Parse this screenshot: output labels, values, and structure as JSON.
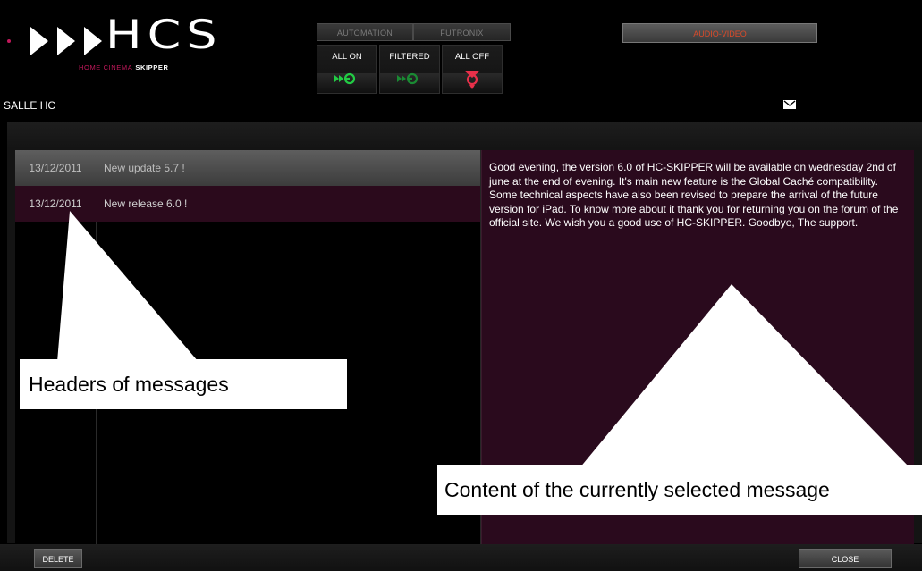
{
  "app": {
    "logo_text": "HCS",
    "logo_sub_1": "HOME CINEMA",
    "logo_sub_2": "SKIPPER"
  },
  "top_tabs": {
    "automation": "AUTOMATION",
    "futronix": "FUTRONIX",
    "audio_video": "AUDIO-VIDEO"
  },
  "mode_buttons": [
    {
      "label": "ALL ON",
      "icon": "power-on-icon",
      "color": "#22cc44"
    },
    {
      "label": "FILTERED",
      "icon": "power-filtered-icon",
      "color": "#22cc44"
    },
    {
      "label": "ALL OFF",
      "icon": "power-off-icon",
      "color": "#e8304a"
    }
  ],
  "header": {
    "room": "SALLE HC",
    "mail_icon": "envelope-icon"
  },
  "messages": [
    {
      "date": "13/12/2011",
      "title": "New update 5.7 !"
    },
    {
      "date": "13/12/2011",
      "title": "New release 6.0 !"
    }
  ],
  "selected_message": {
    "body": "Good evening, the version 6.0 of HC-SKIPPER will be available on wednesday 2nd of june at the end of evening. It's main new feature is the Global Caché compatibility. Some technical aspects have also been revised to prepare the arrival of the future version for iPad. To know more about it thank you for returning you on the forum of the official site. We wish you a good use of HC-SKIPPER. Goodbye, The support."
  },
  "footer": {
    "delete_label": "DELETE",
    "close_label": "CLOSE"
  },
  "annotations": {
    "headers_label": "Headers of messages",
    "content_label": "Content of the currently selected message"
  },
  "colors": {
    "accent": "#c2185b",
    "message_bg": "#2a0a1d",
    "av_tab_text": "#d94a2a"
  }
}
